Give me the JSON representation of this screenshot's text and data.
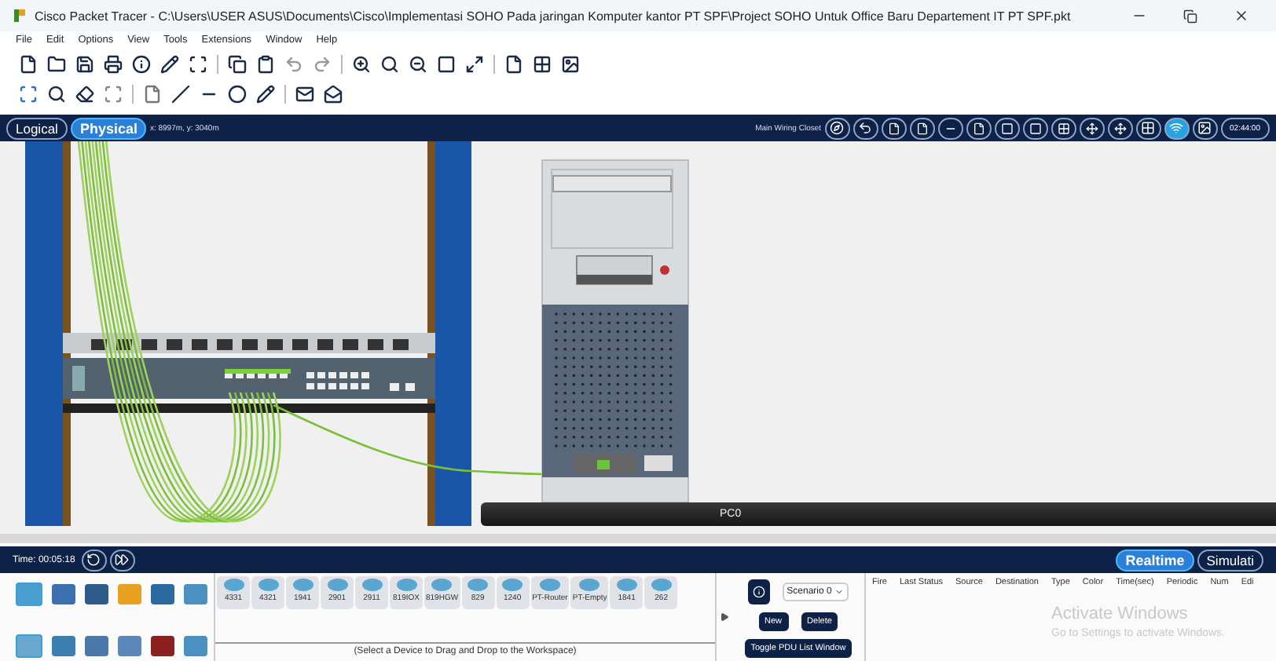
{
  "window": {
    "title": "Cisco Packet Tracer - C:\\Users\\USER ASUS\\Documents\\Cisco\\Implementasi SOHO Pada jaringan Komputer kantor PT SPF\\Project SOHO Untuk Office Baru Departement IT PT SPF.pkt"
  },
  "menu": [
    "File",
    "Edit",
    "Options",
    "View",
    "Tools",
    "Extensions",
    "Window",
    "Help"
  ],
  "view_tabs": [
    {
      "label": "Logical",
      "selected": false
    },
    {
      "label": "Physical",
      "selected": true
    }
  ],
  "coordinates": "x: 8997m, y: 3040m",
  "location": "Main Wiring Closet",
  "clock": "02:44:00",
  "canvas": {
    "device_label": "PC0"
  },
  "time_bar": {
    "time": "Time: 00:05:18"
  },
  "mode_tabs": [
    {
      "label": "Realtime",
      "selected": true
    },
    {
      "label": "Simulati",
      "selected": false
    }
  ],
  "devices": [
    "4331",
    "4321",
    "1941",
    "2901",
    "2911",
    "819IOX",
    "819HGW",
    "829",
    "1240",
    "PT-Router",
    "PT-Empty",
    "1841",
    "262"
  ],
  "device_hint": "(Select a Device to Drag and Drop to the Workspace)",
  "scenario": {
    "value": "Scenario 0",
    "buttons": [
      "New",
      "Delete"
    ],
    "toggle": "Toggle PDU List Window"
  },
  "pdu_columns": [
    "Fire",
    "Last Status",
    "Source",
    "Destination",
    "Type",
    "Color",
    "Time(sec)",
    "Periodic",
    "Num",
    "Edi"
  ],
  "activation": {
    "title": "Activate Windows",
    "hint": "Go to Settings to activate Windows."
  }
}
